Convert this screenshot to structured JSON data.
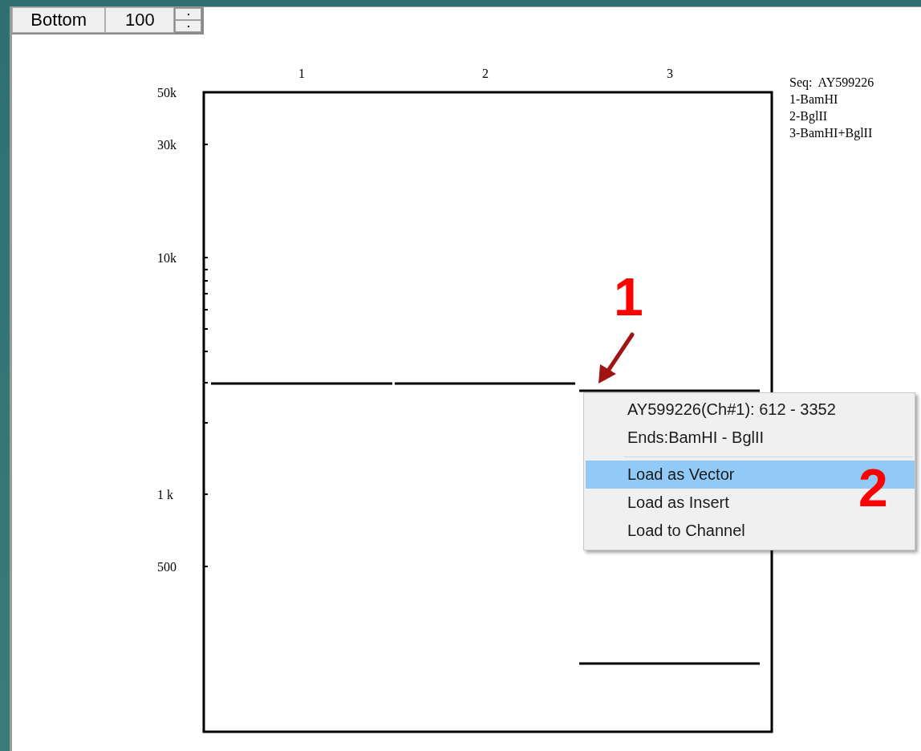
{
  "toolbar": {
    "side_button": "Bottom",
    "zoom_field": "100"
  },
  "gel": {
    "lanes": [
      "1",
      "2",
      "3"
    ],
    "y_axis_labels": [
      "50k",
      "30k",
      "10k",
      "1 k",
      "500"
    ],
    "legend": [
      "Seq:  AY599226",
      "1-BamHI",
      "2-BglII",
      "3-BamHI+BglII"
    ]
  },
  "context_menu": {
    "info": [
      "AY599226(Ch#1): 612 - 3352",
      "Ends:BamHI - BglII"
    ],
    "items": [
      {
        "label": "Load as Vector",
        "selected": true
      },
      {
        "label": "Load as Insert",
        "selected": false
      },
      {
        "label": "Load to Channel",
        "selected": false
      }
    ]
  },
  "annotations": [
    "1",
    "2"
  ]
}
